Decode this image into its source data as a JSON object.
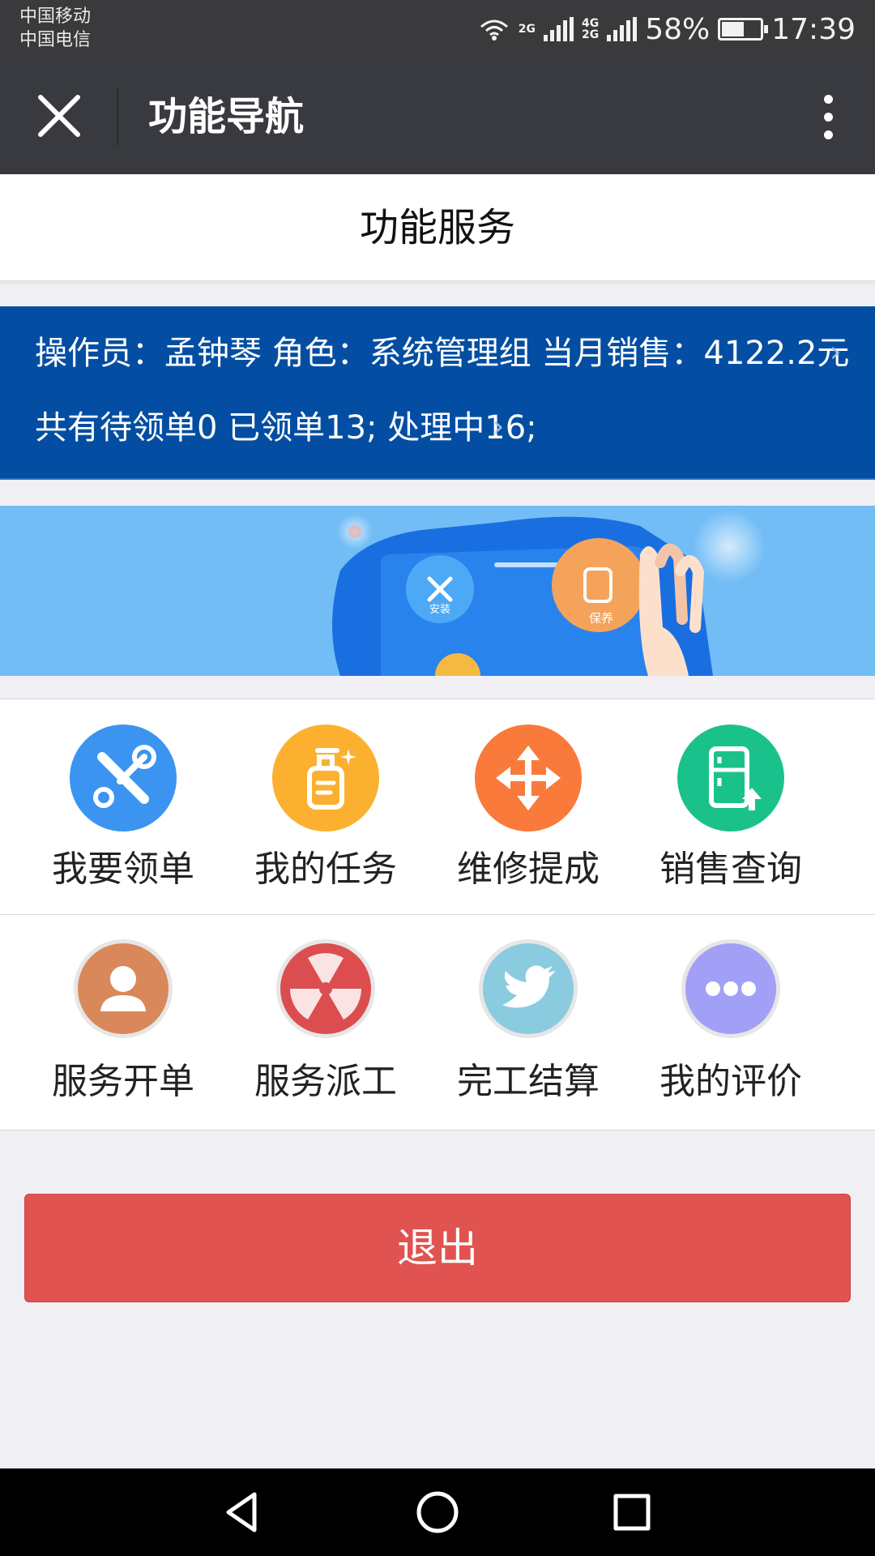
{
  "status_bar": {
    "carrier_1": "中国移动",
    "carrier_2": "中国电信",
    "net_1": "2G",
    "net_2": "4G",
    "net_3": "2G",
    "battery": "58%",
    "battery_level": 0.58,
    "time": "17:39"
  },
  "nav": {
    "title": "功能导航"
  },
  "header": {
    "title": "功能服务"
  },
  "info": {
    "line1": "操作员：孟钟琴 角色：系统管理组 当月销售：4122.2元",
    "line2": "共有待领单0 已领单13; 处理中16;"
  },
  "banner": {
    "badge_install": "安装",
    "badge_maintain": "保养"
  },
  "grid": {
    "row1": [
      {
        "label": "我要领单",
        "icon": "tools-icon",
        "color": "#3b94f0"
      },
      {
        "label": "我的任务",
        "icon": "bottle-icon",
        "color": "#fbb12f"
      },
      {
        "label": "维修提成",
        "icon": "move-arrows-icon",
        "color": "#f97a3a"
      },
      {
        "label": "销售查询",
        "icon": "fridge-icon",
        "color": "#1bc18b"
      }
    ],
    "row2": [
      {
        "label": "服务开单",
        "icon": "user-icon",
        "color": "#d8885a"
      },
      {
        "label": "服务派工",
        "icon": "radiation-icon",
        "color": "#dc4d4f"
      },
      {
        "label": "完工结算",
        "icon": "twitter-bird-icon",
        "color": "#8acbe0"
      },
      {
        "label": "我的评价",
        "icon": "more-dots-icon",
        "color": "#a19ff6"
      }
    ]
  },
  "logout": {
    "label": "退出"
  }
}
